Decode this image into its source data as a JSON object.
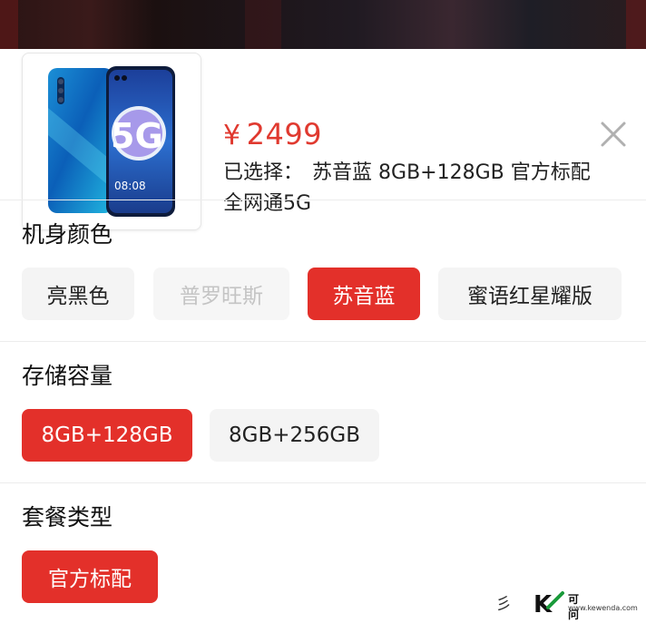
{
  "product": {
    "image_icon": "phone-5g-image",
    "currency_symbol": "¥",
    "price": "2499",
    "selected_label": "已选择：",
    "selected_color": "苏音蓝",
    "selected_spec": "8GB+128GB 官方标配",
    "selected_network": "全网通5G"
  },
  "close_icon": "close-icon",
  "sections": {
    "color": {
      "title": "机身颜色",
      "options": [
        {
          "label": "亮黑色",
          "state": "normal"
        },
        {
          "label": "普罗旺斯",
          "state": "disabled"
        },
        {
          "label": "苏音蓝",
          "state": "selected"
        },
        {
          "label": "蜜语红星耀版",
          "state": "normal"
        }
      ]
    },
    "storage": {
      "title": "存储容量",
      "options": [
        {
          "label": "8GB+128GB",
          "state": "selected"
        },
        {
          "label": "8GB+256GB",
          "state": "normal"
        }
      ]
    },
    "package": {
      "title": "套餐类型",
      "options": [
        {
          "label": "官方标配",
          "state": "selected"
        }
      ]
    }
  },
  "watermark": {
    "glyph": "彡",
    "logo_letter": "K",
    "logo_text": "可问答",
    "logo_url": "www.kewenda.com"
  },
  "colors": {
    "accent": "#e3302a",
    "price": "#e0392f",
    "chip_bg": "#f4f4f4",
    "disabled_text": "#c4c4c4"
  }
}
